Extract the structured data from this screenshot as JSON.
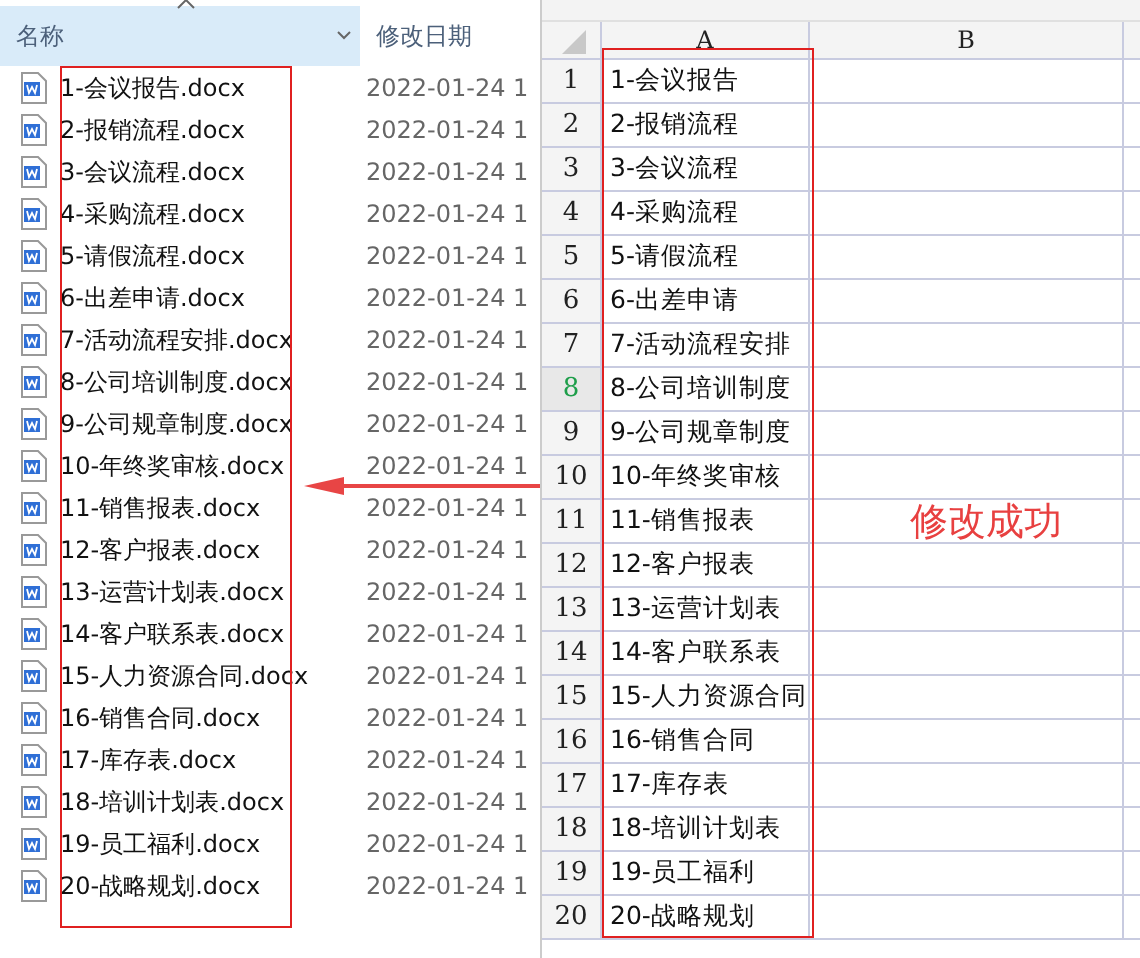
{
  "explorer": {
    "columns": [
      {
        "label": "名称",
        "sorted": true
      },
      {
        "label": "修改日期",
        "sorted": false
      }
    ],
    "files": [
      {
        "name": "1-会议报告.docx",
        "date": "2022-01-24 1"
      },
      {
        "name": "2-报销流程.docx",
        "date": "2022-01-24 1"
      },
      {
        "name": "3-会议流程.docx",
        "date": "2022-01-24 1"
      },
      {
        "name": "4-采购流程.docx",
        "date": "2022-01-24 1"
      },
      {
        "name": "5-请假流程.docx",
        "date": "2022-01-24 1"
      },
      {
        "name": "6-出差申请.docx",
        "date": "2022-01-24 1"
      },
      {
        "name": "7-活动流程安排.docx",
        "date": "2022-01-24 1"
      },
      {
        "name": "8-公司培训制度.docx",
        "date": "2022-01-24 1"
      },
      {
        "name": "9-公司规章制度.docx",
        "date": "2022-01-24 1"
      },
      {
        "name": "10-年终奖审核.docx",
        "date": "2022-01-24 1"
      },
      {
        "name": "11-销售报表.docx",
        "date": "2022-01-24 1"
      },
      {
        "name": "12-客户报表.docx",
        "date": "2022-01-24 1"
      },
      {
        "name": "13-运营计划表.docx",
        "date": "2022-01-24 1"
      },
      {
        "name": "14-客户联系表.docx",
        "date": "2022-01-24 1"
      },
      {
        "name": "15-人力资源合同.docx",
        "date": "2022-01-24 1"
      },
      {
        "name": "16-销售合同.docx",
        "date": "2022-01-24 1"
      },
      {
        "name": "17-库存表.docx",
        "date": "2022-01-24 1"
      },
      {
        "name": "18-培训计划表.docx",
        "date": "2022-01-24 1"
      },
      {
        "name": "19-员工福利.docx",
        "date": "2022-01-24 1"
      },
      {
        "name": "20-战略规划.docx",
        "date": "2022-01-24 1"
      }
    ]
  },
  "sheet": {
    "columns": [
      "A",
      "B"
    ],
    "rows": [
      {
        "number": "1",
        "value": "1-会议报告",
        "selected": false
      },
      {
        "number": "2",
        "value": "2-报销流程",
        "selected": false
      },
      {
        "number": "3",
        "value": "3-会议流程",
        "selected": false
      },
      {
        "number": "4",
        "value": "4-采购流程",
        "selected": false
      },
      {
        "number": "5",
        "value": "5-请假流程",
        "selected": false
      },
      {
        "number": "6",
        "value": "6-出差申请",
        "selected": false
      },
      {
        "number": "7",
        "value": "7-活动流程安排",
        "selected": false
      },
      {
        "number": "8",
        "value": "8-公司培训制度",
        "selected": true
      },
      {
        "number": "9",
        "value": "9-公司规章制度",
        "selected": false
      },
      {
        "number": "10",
        "value": "10-年终奖审核",
        "selected": false
      },
      {
        "number": "11",
        "value": "11-销售报表",
        "selected": false
      },
      {
        "number": "12",
        "value": "12-客户报表",
        "selected": false
      },
      {
        "number": "13",
        "value": "13-运营计划表",
        "selected": false
      },
      {
        "number": "14",
        "value": "14-客户联系表",
        "selected": false
      },
      {
        "number": "15",
        "value": "15-人力资源合同",
        "selected": false
      },
      {
        "number": "16",
        "value": "16-销售合同",
        "selected": false
      },
      {
        "number": "17",
        "value": "17-库存表",
        "selected": false
      },
      {
        "number": "18",
        "value": "18-培训计划表",
        "selected": false
      },
      {
        "number": "19",
        "value": "19-员工福利",
        "selected": false
      },
      {
        "number": "20",
        "value": "20-战略规划",
        "selected": false
      }
    ]
  },
  "annotation": {
    "text": "修改成功"
  }
}
